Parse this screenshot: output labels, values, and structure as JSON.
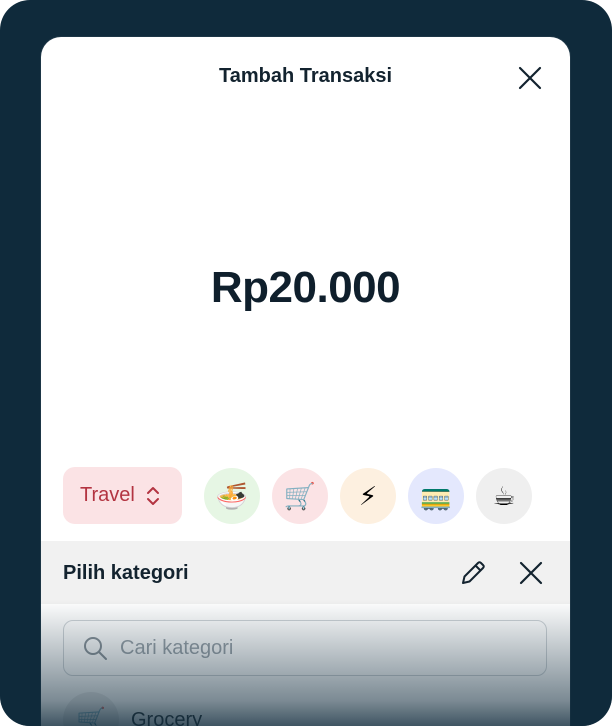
{
  "header": {
    "title": "Tambah Transaksi"
  },
  "amount": "Rp20.000",
  "category_selector": {
    "selected": "Travel"
  },
  "quick_categories": [
    {
      "icon": "noodle-bowl-icon",
      "glyph": "🍜",
      "bg": "#e6f6e4"
    },
    {
      "icon": "shopping-cart-icon",
      "glyph": "🛒",
      "bg": "#fbe3e5"
    },
    {
      "icon": "lightning-icon",
      "glyph": "⚡",
      "bg": "#fdf0e0"
    },
    {
      "icon": "train-icon",
      "glyph": "🚃",
      "bg": "#e4e8fd"
    },
    {
      "icon": "coffee-icon",
      "glyph": "☕",
      "bg": "#efefef"
    }
  ],
  "picker": {
    "title": "Pilih kategori",
    "search_placeholder": "Cari kategori",
    "items": [
      {
        "label": "Grocery",
        "icon": "shopping-cart-icon",
        "glyph": "🛒"
      }
    ]
  },
  "colors": {
    "frame": "#0f2a3b",
    "accent_red": "#b33441",
    "accent_red_bg": "#fbe3e5",
    "picker_header_bg": "#f1f1f1"
  }
}
